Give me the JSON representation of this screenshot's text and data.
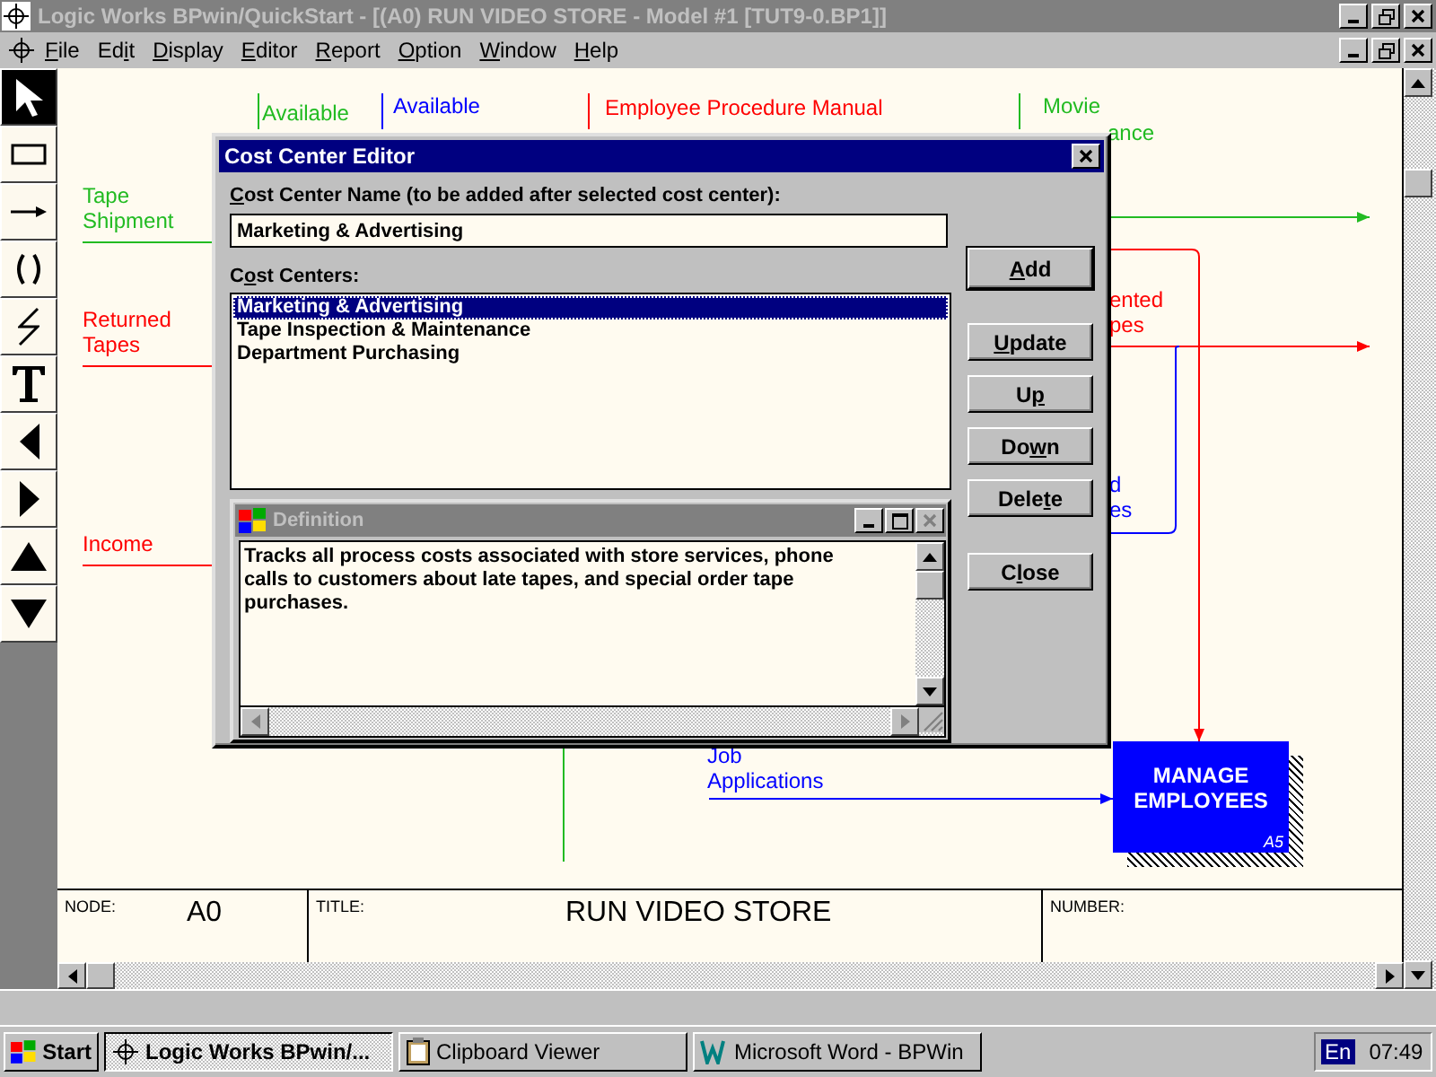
{
  "window": {
    "title": "Logic Works BPwin/QuickStart - [(A0) RUN VIDEO STORE - Model #1  [TUT9-0.BP1]]"
  },
  "menu": [
    {
      "label": "File"
    },
    {
      "label": "Edit"
    },
    {
      "label": "Display"
    },
    {
      "label": "Editor"
    },
    {
      "label": "Report"
    },
    {
      "label": "Option"
    },
    {
      "label": "Window"
    },
    {
      "label": "Help"
    }
  ],
  "tools": [
    {
      "kind": "pointer",
      "selected": true
    },
    {
      "kind": "box",
      "selected": false
    },
    {
      "kind": "arrow",
      "selected": false
    },
    {
      "kind": "parens",
      "selected": false
    },
    {
      "kind": "squiggle",
      "selected": false
    },
    {
      "kind": "text",
      "selected": false
    },
    {
      "kind": "left",
      "selected": false
    },
    {
      "kind": "right",
      "selected": false
    },
    {
      "kind": "up",
      "selected": false
    },
    {
      "kind": "down",
      "selected": false
    }
  ],
  "diagram": {
    "labels": [
      {
        "lines": [
          "Available"
        ],
        "color": "#22bb22"
      },
      {
        "lines": [
          "Available"
        ],
        "color": "#0000ff"
      },
      {
        "lines": [
          "Employee Procedure Manual"
        ],
        "color": "#ff0000"
      },
      {
        "lines": [
          "Movie"
        ],
        "color": "#22bb22"
      },
      {
        "lines": [
          "ance"
        ],
        "color": "#22bb22"
      },
      {
        "lines": [
          "Tape",
          "Shipment"
        ],
        "color": "#22bb22"
      },
      {
        "lines": [
          "Returned",
          "Tapes"
        ],
        "color": "#ff0000"
      },
      {
        "lines": [
          "Income"
        ],
        "color": "#ff0000"
      },
      {
        "lines": [
          "ented",
          "pes"
        ],
        "color": "#ff0000"
      },
      {
        "lines": [
          "d",
          "es"
        ],
        "color": "#0000ff"
      },
      {
        "lines": [
          "Job",
          "Applications"
        ],
        "color": "#0000ff"
      }
    ],
    "activity": {
      "lines": [
        "MANAGE",
        "EMPLOYEES"
      ],
      "number": "A5"
    },
    "frame": {
      "node_label": "NODE:",
      "node": "A0",
      "title_label": "TITLE:",
      "title": "RUN VIDEO STORE",
      "number_label": "NUMBER:"
    }
  },
  "dialog": {
    "title": "Cost Center Editor",
    "name_label": "Cost Center Name (to be added after selected cost center):",
    "name_value": "Marketing & Advertising",
    "list_label": "Cost Centers:",
    "items": [
      {
        "label": "Marketing & Advertising",
        "selected": true
      },
      {
        "label": "Tape Inspection & Maintenance",
        "selected": false
      },
      {
        "label": "Department Purchasing",
        "selected": false
      }
    ],
    "buttons": [
      {
        "label": "Add",
        "default": true
      },
      {
        "label": "Update",
        "default": false
      },
      {
        "label": "Up",
        "default": false
      },
      {
        "label": "Down",
        "default": false
      },
      {
        "label": "Delete",
        "default": false
      },
      {
        "label": "Close",
        "default": false
      }
    ],
    "definition": {
      "title": "Definition",
      "text": "Tracks all process costs associated with store services, phone calls to customers about late tapes, and special order tape purchases."
    }
  },
  "taskbar": {
    "start": "Start",
    "tasks": [
      {
        "label": "Logic Works BPwin/...",
        "selected": true
      },
      {
        "label": "Clipboard Viewer",
        "selected": false
      },
      {
        "label": "Microsoft Word - BPWin",
        "selected": false
      }
    ],
    "language": "En",
    "clock": "07:49"
  }
}
